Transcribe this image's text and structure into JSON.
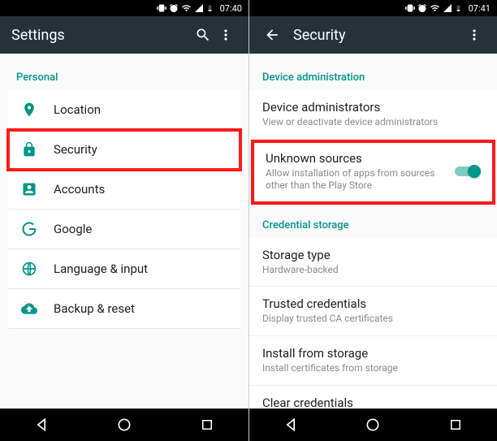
{
  "left": {
    "status_time": "07:40",
    "appbar_title": "Settings",
    "section_header": "Personal",
    "items": [
      {
        "label": "Location"
      },
      {
        "label": "Security"
      },
      {
        "label": "Accounts"
      },
      {
        "label": "Google"
      },
      {
        "label": "Language & input"
      },
      {
        "label": "Backup & reset"
      }
    ]
  },
  "right": {
    "status_time": "07:41",
    "appbar_title": "Security",
    "sections": {
      "device_admin": {
        "header": "Device administration",
        "items": [
          {
            "title": "Device administrators",
            "sub": "View or deactivate device administrators"
          },
          {
            "title": "Unknown sources",
            "sub": "Allow installation of apps from sources other than the Play Store"
          }
        ]
      },
      "credential": {
        "header": "Credential storage",
        "items": [
          {
            "title": "Storage type",
            "sub": "Hardware-backed"
          },
          {
            "title": "Trusted credentials",
            "sub": "Display trusted CA certificates"
          },
          {
            "title": "Install from storage",
            "sub": "Install certificates from storage"
          },
          {
            "title": "Clear credentials"
          }
        ]
      }
    }
  }
}
